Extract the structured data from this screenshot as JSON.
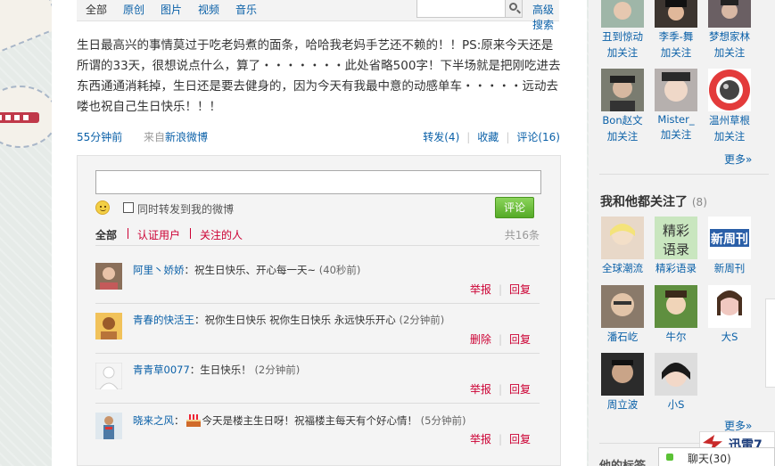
{
  "filters": {
    "tabs": [
      "全部",
      "原创",
      "图片",
      "视频",
      "音乐"
    ],
    "advanced_search": "高级搜索"
  },
  "post": {
    "text": "生日最高兴的事情莫过于吃老妈煮的面条，哈哈我老妈手艺还不赖的！！PS:原来今天还是所谓的33天，很想说点什么，算了・・・・・・・此处省略500字！下半场就是把刚吃进去东西通通消耗掉，生日还是要去健身的，因为今天有我最中意的动感单车・・・・・远动去喽也祝自己生日快乐！！！",
    "time": "55分钟前",
    "from_label": "来自",
    "source": "新浪微博",
    "forward": "转发(4)",
    "favorite": "收藏",
    "comment": "评论(16)"
  },
  "comment_box": {
    "also_forward_label": "同时转发到我的微博",
    "submit_label": "评论",
    "tabs": [
      "全部",
      "认证用户",
      "关注的人"
    ],
    "count": "共16条"
  },
  "comments": [
    {
      "user": "阿里丶娇娇",
      "text": "：祝生日快乐、开心每一天~",
      "time": "(40秒前)",
      "action1": "举报",
      "action2": "回复",
      "avatar_color": "#8a6f5a"
    },
    {
      "user": "青春的快活王",
      "text": "：祝你生日快乐 祝你生日快乐 永远快乐开心",
      "time": "(2分钟前)",
      "action1": "删除",
      "action2": "回复",
      "avatar_color": "#b8743a"
    },
    {
      "user": "青青草0077",
      "text": "：生日快乐！",
      "time": "(2分钟前)",
      "action1": "举报",
      "action2": "回复",
      "avatar_color": "#e8e8e8"
    },
    {
      "user": "晓来之风",
      "text": "今天是楼主生日呀！祝福楼主每天有个好心情！",
      "time": "(5分钟前)",
      "action1": "举报",
      "action2": "回复",
      "avatar_color": "#4d7aa6"
    }
  ],
  "sidebar": {
    "following": [
      {
        "name": "丑到惊动",
        "add": "加关注",
        "color": "#9fb6a8"
      },
      {
        "name": "李季-舞",
        "add": "加关注",
        "color": "#3c3530"
      },
      {
        "name": "梦想家林",
        "add": "加关注",
        "color": "#6a5f63"
      },
      {
        "name": "Bon赵文",
        "add": "加关注",
        "color": "#7a7c70"
      },
      {
        "name": "Mister_",
        "add": "加关注",
        "color": "#b6b0ae"
      },
      {
        "name": "温州草根",
        "add": "加关注",
        "color": "#e33b3b"
      }
    ],
    "more": "更多»",
    "common_title": "我和他都关注了",
    "common_count": "(8)",
    "common": [
      {
        "name": "全球潮流",
        "color": "#e8d8c8"
      },
      {
        "name": "精彩语录",
        "color": "#c9e6bf"
      },
      {
        "name": "新周刊",
        "color": "#2a5fa8"
      },
      {
        "name": "潘石屹",
        "color": "#8a7a6a"
      },
      {
        "name": "牛尔",
        "color": "#5f8f3f"
      },
      {
        "name": "大S",
        "color": "#f0c8c0"
      },
      {
        "name": "周立波",
        "color": "#2b2b2b"
      },
      {
        "name": "小S",
        "color": "#3a3030"
      }
    ],
    "more2": "更多»",
    "bottom_partial": "他的标签",
    "xunlei": "迅雷7",
    "chat": "聊天(30)"
  }
}
